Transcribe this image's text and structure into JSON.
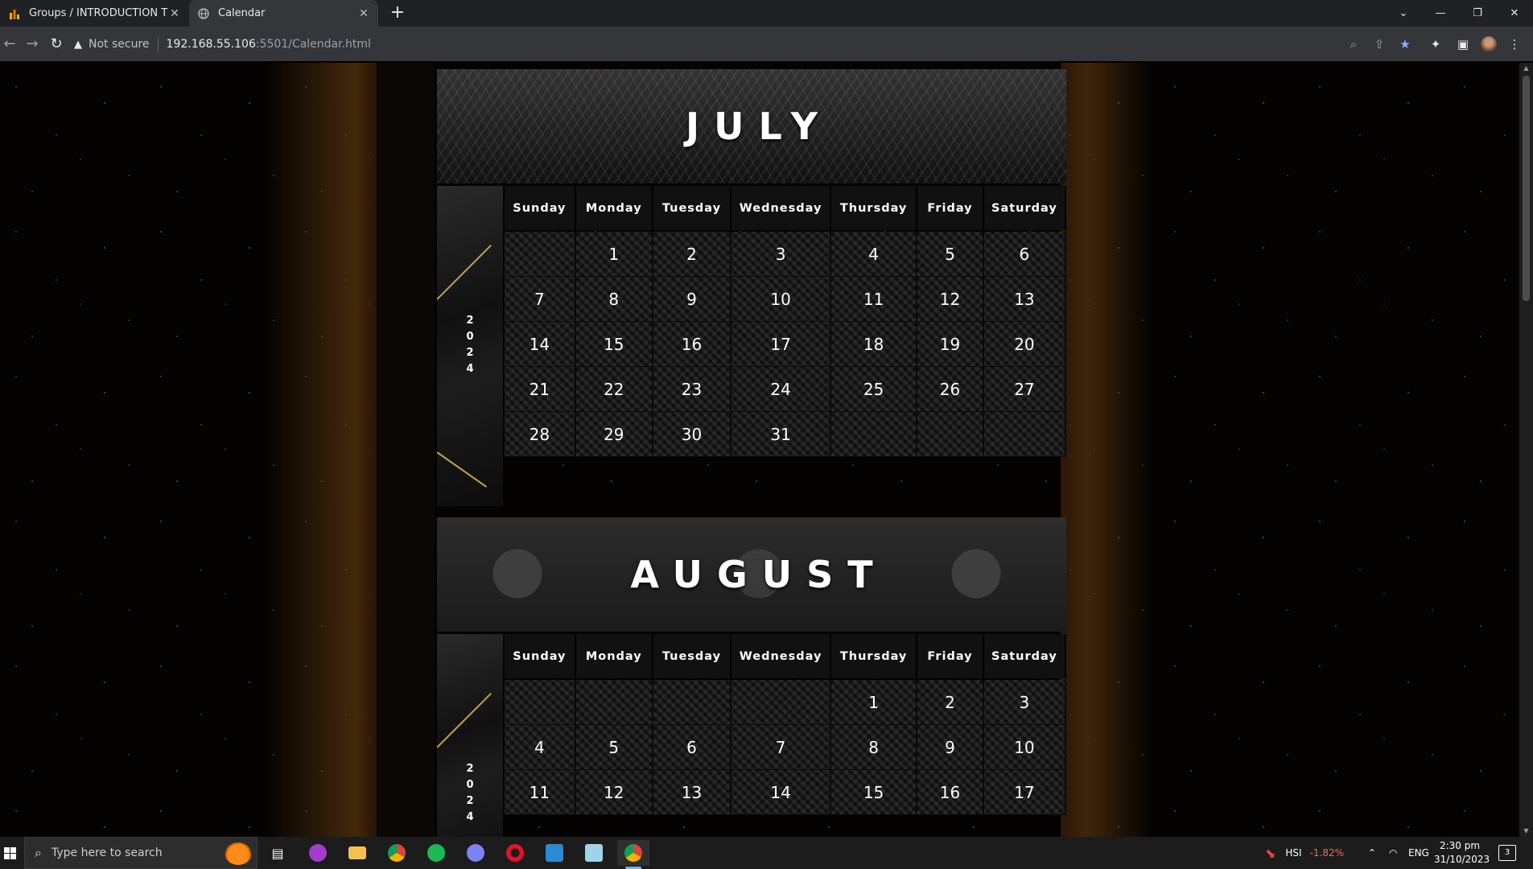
{
  "browser": {
    "tabs": [
      {
        "title": "Groups / INTRODUCTION TO CO",
        "active": false,
        "icon": "bar-chart-icon"
      },
      {
        "title": "Calendar",
        "active": true,
        "icon": "globe-icon"
      }
    ],
    "new_tab_label": "+",
    "security_label": "Not secure",
    "url_host": "192.168.55.106",
    "url_path": ":5501/Calendar.html"
  },
  "colors": {
    "gold_accent": "#c8a24a",
    "cell_bg": "#161616",
    "header_bg": "#111111"
  },
  "calendar": {
    "weekdays": [
      "Sunday",
      "Monday",
      "Tuesday",
      "Wednesday",
      "Thursday",
      "Friday",
      "Saturday"
    ],
    "months": [
      {
        "name": "JULY",
        "year_digits": [
          "2",
          "0",
          "2",
          "4"
        ],
        "weeks": [
          [
            "",
            "1",
            "2",
            "3",
            "4",
            "5",
            "6"
          ],
          [
            "7",
            "8",
            "9",
            "10",
            "11",
            "12",
            "13"
          ],
          [
            "14",
            "15",
            "16",
            "17",
            "18",
            "19",
            "20"
          ],
          [
            "21",
            "22",
            "23",
            "24",
            "25",
            "26",
            "27"
          ],
          [
            "28",
            "29",
            "30",
            "31",
            "",
            "",
            ""
          ]
        ]
      },
      {
        "name": "AUGUST",
        "year_digits": [
          "2",
          "0",
          "2",
          "4"
        ],
        "weeks": [
          [
            "",
            "",
            "",
            "",
            "1",
            "2",
            "3"
          ],
          [
            "4",
            "5",
            "6",
            "7",
            "8",
            "9",
            "10"
          ],
          [
            "11",
            "12",
            "13",
            "14",
            "15",
            "16",
            "17"
          ]
        ]
      }
    ]
  },
  "taskbar": {
    "search_placeholder": "Type here to search",
    "stock_name": "HSI",
    "stock_change": "-1.82%",
    "language": "ENG",
    "time": "2:30 pm",
    "date": "31/10/2023",
    "notification_count": "3"
  }
}
